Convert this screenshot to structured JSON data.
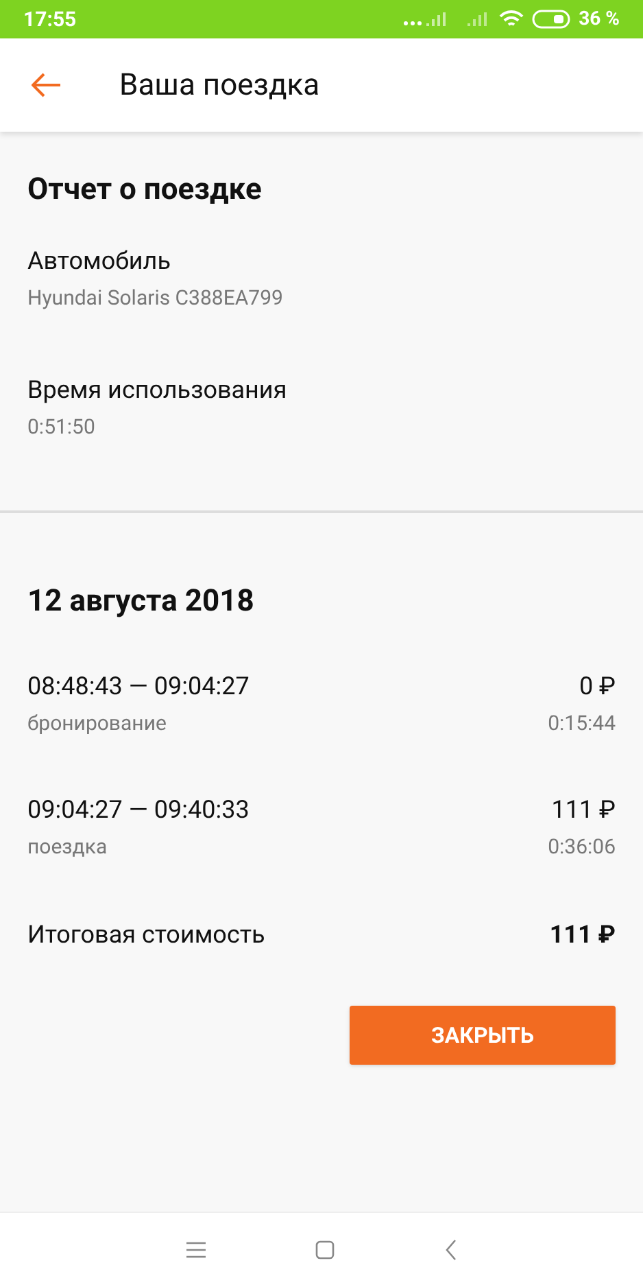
{
  "status_bar": {
    "time": "17:55",
    "battery": "36 %"
  },
  "app_bar": {
    "title": "Ваша поездка"
  },
  "report": {
    "title": "Отчет о поездке",
    "fields": [
      {
        "label": "Автомобиль",
        "value": "Hyundai Solaris С388ЕА799"
      },
      {
        "label": "Время использования",
        "value": "0:51:50"
      }
    ]
  },
  "day": {
    "date": "12 августа 2018",
    "segments": [
      {
        "interval": "08:48:43 — 09:04:27",
        "type": "бронирование",
        "price": "0 ₽",
        "duration": "0:15:44"
      },
      {
        "interval": "09:04:27 — 09:40:33",
        "type": "поездка",
        "price": "111 ₽",
        "duration": "0:36:06"
      }
    ],
    "total_label": "Итоговая стоимость",
    "total": "111 ₽"
  },
  "buttons": [
    "ЗАКРЫТЬ"
  ]
}
